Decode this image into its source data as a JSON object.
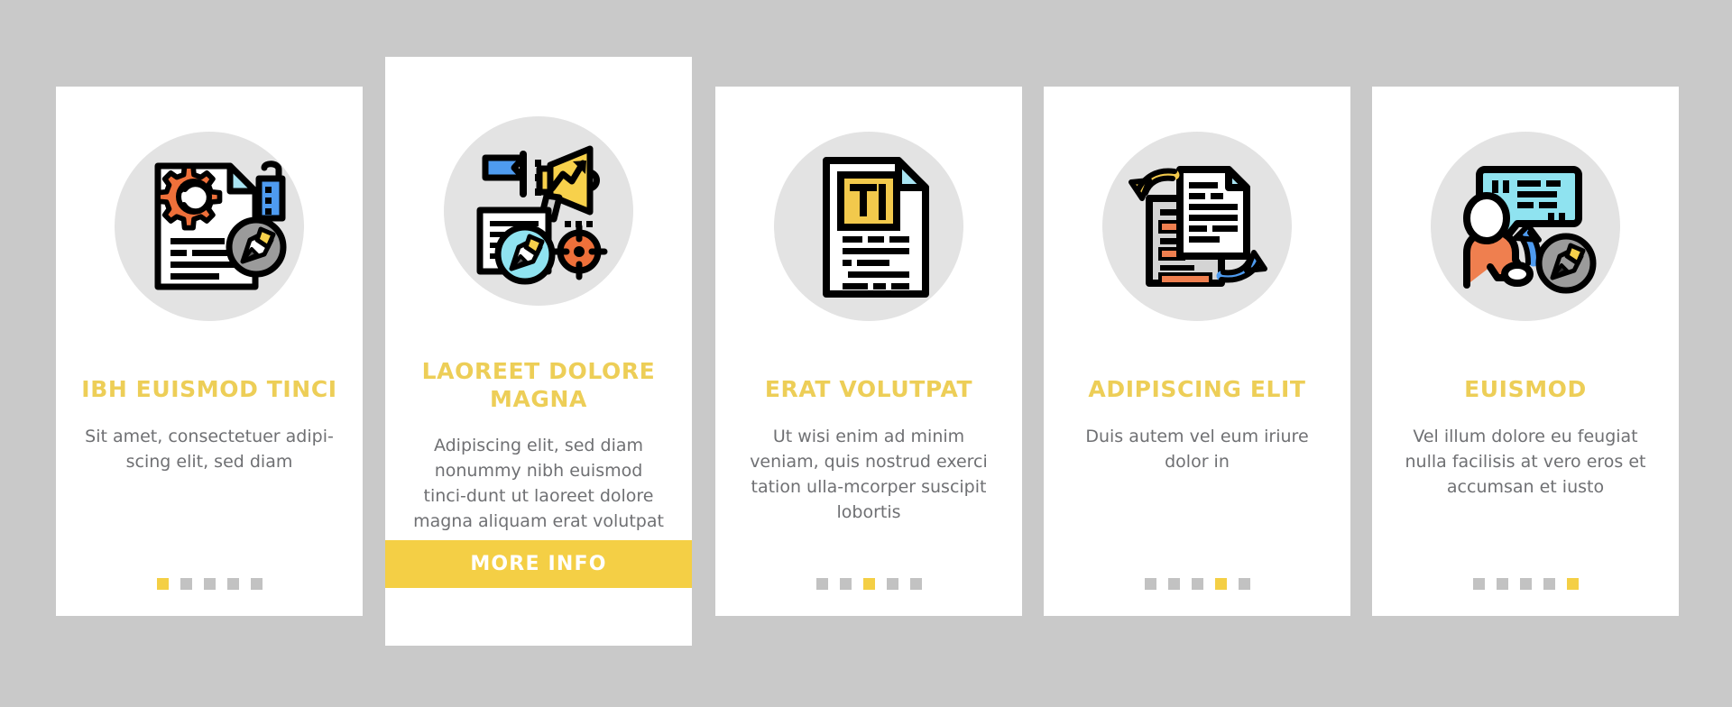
{
  "page": {
    "background_color": "#c9c9c9",
    "accent_color": "#f4cf45",
    "title_color": "#edce57",
    "body_text_color": "#6f7073",
    "card_background": "#ffffff",
    "icon_circle_color": "#e3e3e3"
  },
  "cards": [
    {
      "id": "card-1",
      "icon_name": "document-gear-tag-pen-icon",
      "title": "IBH EUISMOD TINCI",
      "description": "Sit amet, consectetuer adipi-scing elit, sed diam",
      "dots": {
        "count": 5,
        "active_index": 0
      },
      "featured": false
    },
    {
      "id": "card-2",
      "icon_name": "megaphone-flag-target-document-icon",
      "title": "LAOREET DOLORE MAGNA",
      "description": "Adipiscing elit, sed diam nonummy nibh euismod tinci-dunt ut laoreet dolore magna aliquam erat volutpat",
      "cta_label": "MORE INFO",
      "featured": true
    },
    {
      "id": "card-3",
      "icon_name": "text-document-typography-icon",
      "title": "ERAT VOLUTPAT",
      "description": "Ut wisi enim ad minim veniam, quis nostrud exerci tation ulla-mcorper suscipit lobortis",
      "dots": {
        "count": 5,
        "active_index": 2
      },
      "featured": false
    },
    {
      "id": "card-4",
      "icon_name": "document-compare-arrows-icon",
      "title": "ADIPISCING ELIT",
      "description": "Duis autem vel eum iriure dolor in",
      "dots": {
        "count": 5,
        "active_index": 3
      },
      "featured": false
    },
    {
      "id": "card-5",
      "icon_name": "person-speech-bubble-pen-icon",
      "title": "EUISMOD",
      "description": "Vel illum dolore eu feugiat nulla facilisis at vero eros et accumsan et iusto",
      "dots": {
        "count": 5,
        "active_index": 4
      },
      "featured": false
    }
  ]
}
